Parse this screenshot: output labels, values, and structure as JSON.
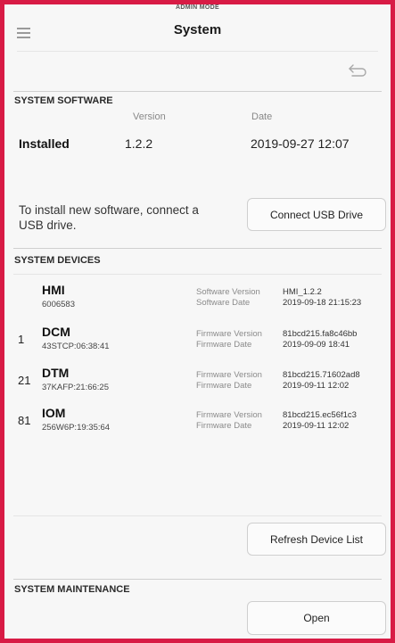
{
  "header": {
    "mode_label": "ADMIN MODE",
    "title": "System"
  },
  "software": {
    "section_title": "SYSTEM SOFTWARE",
    "col_version": "Version",
    "col_date": "Date",
    "installed_label": "Installed",
    "installed_version": "1.2.2",
    "installed_date": "2019-09-27 12:07",
    "install_message": "To install new software, connect a USB drive.",
    "connect_button": "Connect USB Drive"
  },
  "devices": {
    "section_title": "SYSTEM DEVICES",
    "refresh_button": "Refresh Device List",
    "rows": [
      {
        "address": "",
        "name": "HMI",
        "serial": "6006583",
        "label1": "Software Version",
        "label2": "Software Date",
        "value1": "HMI_1.2.2",
        "value2": "2019-09-18 21:15:23"
      },
      {
        "address": "1",
        "name": "DCM",
        "serial": "43STCP:06:38:41",
        "label1": "Firmware Version",
        "label2": "Firmware Date",
        "value1": "81bcd215.fa8c46bb",
        "value2": "2019-09-09 18:41"
      },
      {
        "address": "21",
        "name": "DTM",
        "serial": "37KAFP:21:66:25",
        "label1": "Firmware Version",
        "label2": "Firmware Date",
        "value1": "81bcd215.71602ad8",
        "value2": "2019-09-11 12:02"
      },
      {
        "address": "81",
        "name": "IOM",
        "serial": "256W6P:19:35:64",
        "label1": "Firmware Version",
        "label2": "Firmware Date",
        "value1": "81bcd215.ec56f1c3",
        "value2": "2019-09-11 12:02"
      }
    ]
  },
  "maintenance": {
    "section_title": "SYSTEM MAINTENANCE",
    "open_button": "Open"
  },
  "icons": {
    "menu": "hamburger-menu-icon",
    "back": "back-arrow-icon"
  },
  "colors": {
    "frame_border": "#d81b45",
    "background": "#f7f7f7"
  }
}
